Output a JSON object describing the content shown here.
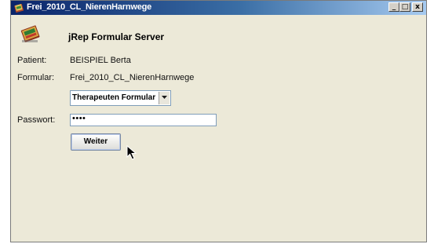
{
  "window": {
    "title": "Frei_2010_CL_NierenHarnwege",
    "minimize": "_",
    "maximize": "□",
    "close": "x"
  },
  "app": {
    "title": "jRep Formular Server"
  },
  "form": {
    "patient_label": "Patient:",
    "patient_value": "BEISPIEL Berta",
    "formular_label": "Formular:",
    "formular_value": "Frei_2010_CL_NierenHarnwege",
    "role_selected": "Therapeuten Formular",
    "password_label": "Passwort:",
    "password_masked": "••••",
    "continue_label": "Weiter"
  }
}
